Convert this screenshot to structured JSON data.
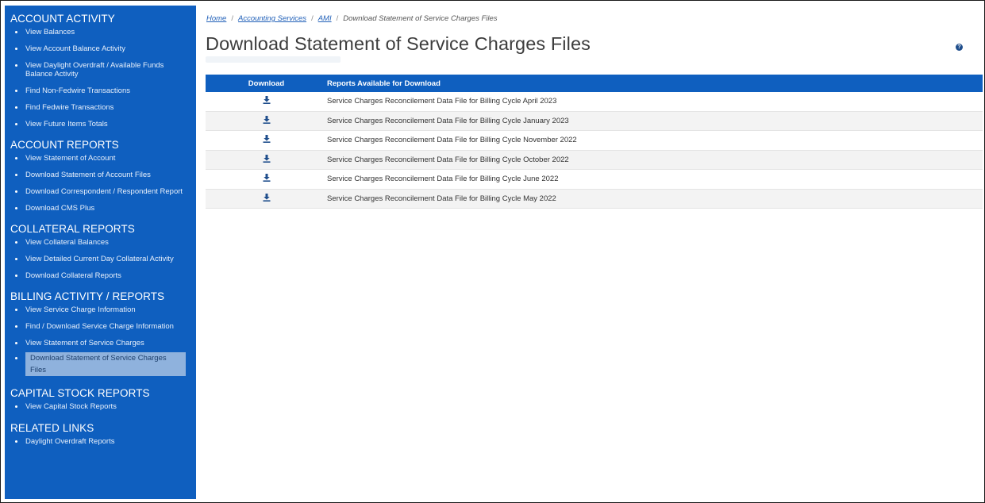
{
  "sidebar": {
    "sections": [
      {
        "title": "ACCOUNT ACTIVITY",
        "items": [
          {
            "label": "View Balances"
          },
          {
            "label": "View Account Balance Activity"
          },
          {
            "label": "View Daylight Overdraft / Available Funds Balance Activity"
          },
          {
            "label": "Find Non-Fedwire Transactions"
          },
          {
            "label": "Find Fedwire Transactions"
          },
          {
            "label": "View Future Items Totals"
          }
        ]
      },
      {
        "title": "ACCOUNT REPORTS",
        "items": [
          {
            "label": "View Statement of Account"
          },
          {
            "label": "Download Statement of Account Files"
          },
          {
            "label": "Download Correspondent / Respondent Report"
          },
          {
            "label": "Download CMS Plus"
          }
        ]
      },
      {
        "title": "COLLATERAL REPORTS",
        "items": [
          {
            "label": "View Collateral Balances"
          },
          {
            "label": "View Detailed Current Day Collateral Activity"
          },
          {
            "label": "Download Collateral Reports"
          }
        ]
      },
      {
        "title": "BILLING ACTIVITY / REPORTS",
        "items": [
          {
            "label": "View Service Charge Information"
          },
          {
            "label": "Find / Download Service Charge Information"
          },
          {
            "label": "View Statement of Service Charges"
          },
          {
            "label": "Download Statement of Service Charges Files",
            "active": true
          }
        ]
      },
      {
        "title": "CAPITAL STOCK REPORTS",
        "items": [
          {
            "label": "View Capital Stock Reports"
          }
        ]
      },
      {
        "title": "RELATED LINKS",
        "items": [
          {
            "label": "Daylight Overdraft Reports"
          }
        ]
      }
    ]
  },
  "breadcrumb": {
    "home": "Home",
    "accounting": "Accounting Services",
    "ami": "AMI",
    "sep": "/",
    "current": "Download Statement of Service Charges Files"
  },
  "page": {
    "title": "Download Statement of Service Charges Files",
    "help_icon": "question-circle-icon"
  },
  "table": {
    "headers": {
      "download": "Download",
      "reports": "Reports Available for Download"
    },
    "rows": [
      {
        "name": "Service Charges Reconcilement Data File for Billing Cycle April 2023"
      },
      {
        "name": "Service Charges Reconcilement Data File for Billing Cycle January 2023"
      },
      {
        "name": "Service Charges Reconcilement Data File for Billing Cycle November 2022"
      },
      {
        "name": "Service Charges Reconcilement Data File for Billing Cycle October 2022"
      },
      {
        "name": "Service Charges Reconcilement Data File for Billing Cycle June 2022"
      },
      {
        "name": "Service Charges Reconcilement Data File for Billing Cycle May 2022"
      }
    ]
  },
  "colors": {
    "brand_blue": "#0f5fbf",
    "active_item": "#8fb2dd",
    "link": "#1f5fb8",
    "download_icon": "#1f4e8c"
  }
}
